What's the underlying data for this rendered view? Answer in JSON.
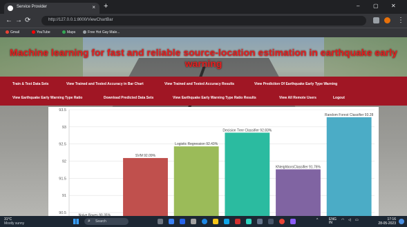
{
  "browser": {
    "tab_title": "Service Provider",
    "tab_close": "×",
    "new_tab": "+",
    "url": "http://127.0.0.1:8000/ViewChartBar",
    "bookmarks": [
      "Gmail",
      "YouTube",
      "Maps",
      "Free Hot Gay Male..."
    ],
    "window_controls": [
      "–",
      "▢",
      "✕"
    ],
    "nav_icons": [
      "back-icon",
      "forward-icon",
      "reload-icon"
    ]
  },
  "page": {
    "heading": "Machine learning for fast and reliable source-location estimation in earthquake early warning",
    "nav_links": [
      "Train & Test Data Sets",
      "View Trained and Tested Accuracy in Bar Chart",
      "View Trained and Tested Accuracy Results",
      "View Prediction Of Earthquake Early Type Warning",
      "View Earthquake Early Warning Type Ratio",
      "Download Predicted Data Sets",
      "View Earthquake Early Warning Type Ratio Results",
      "View All Remote Users",
      "Logout"
    ]
  },
  "chart_data": {
    "type": "bar",
    "categories": [
      "Naive Bayes",
      "SVM",
      "Logistic Regression",
      "Decision Tree Classifier",
      "KNeighborsClassifier",
      "Random Forest Classifier"
    ],
    "labels": [
      "Naive Bayes 90.35%",
      "SVM 92.09%",
      "Logistic Regression 92.43%",
      "Decision Tree Classifier 92.83%",
      "KNeighborsClassifier 91.76%",
      "Random Forest Classifier 93.28"
    ],
    "values": [
      90.35,
      92.09,
      92.43,
      92.83,
      91.76,
      93.28
    ],
    "colors": [
      "#4a8fd0",
      "#c0504d",
      "#9bbb59",
      "#2bbba0",
      "#8064a2",
      "#4bacc6"
    ],
    "yticks": [
      "93.5",
      "93",
      "92.5",
      "92",
      "91.5",
      "91",
      "90.5"
    ],
    "ylim": [
      90.4,
      93.5
    ],
    "grid": true
  },
  "taskbar": {
    "weather_temp": "31°C",
    "weather_desc": "Mostly sunny",
    "search_placeholder": "Search",
    "tray_lang": "ENG",
    "tray_region": "IN",
    "time": "17:16",
    "date": "28-05-2023"
  }
}
